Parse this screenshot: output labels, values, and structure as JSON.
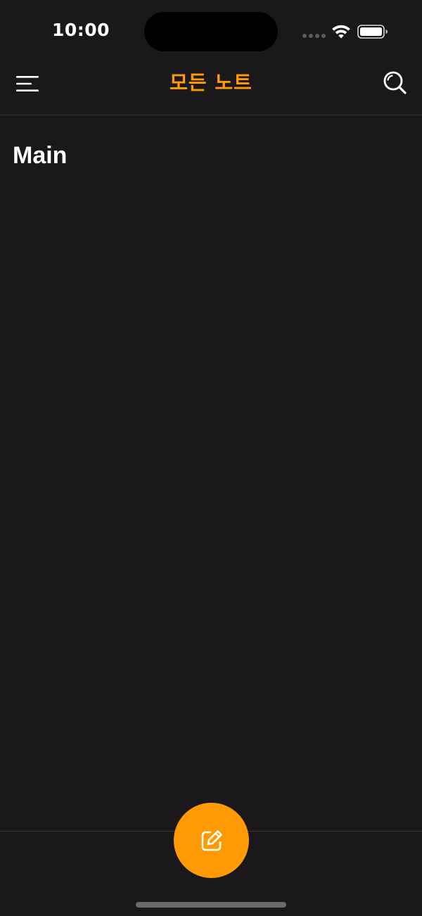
{
  "status_bar": {
    "time": "10:00"
  },
  "nav": {
    "title": "모든 노트",
    "menu_icon": "hamburger-menu-icon",
    "search_icon": "search-icon"
  },
  "content": {
    "folder_title": "Main"
  },
  "compose": {
    "icon": "compose-note-icon"
  },
  "colors": {
    "background": "#1a181b",
    "accent": "#ff9a05",
    "text": "#ffffff"
  }
}
